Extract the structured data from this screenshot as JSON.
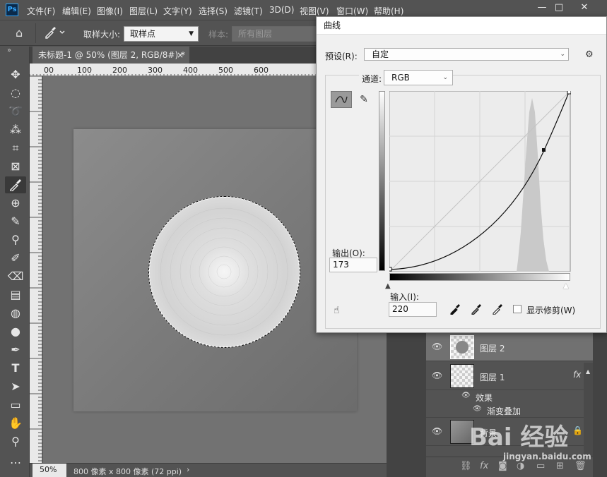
{
  "app": {
    "logo_text": "Ps"
  },
  "menu": [
    "文件(F)",
    "编辑(E)",
    "图像(I)",
    "图层(L)",
    "文字(Y)",
    "选择(S)",
    "滤镜(T)",
    "3D(D)",
    "视图(V)",
    "窗口(W)",
    "帮助(H)"
  ],
  "window_controls": {
    "minimize": "—",
    "maximize": "□",
    "close": "✕"
  },
  "options": {
    "sample_size_label": "取样大小:",
    "sample_size_value": "取样点",
    "sample_label": "样本:",
    "sample_value": "所有图层"
  },
  "document": {
    "tab_title": "未标题-1 @ 50% (图层 2, RGB/8#) *",
    "tab_close": "×",
    "zoom": "50%",
    "info": "800 像素 x 800 像素 (72 ppi)",
    "info_arrow": "›"
  },
  "ruler": {
    "ticks": [
      "00",
      "100",
      "200",
      "300",
      "400",
      "500",
      "600"
    ]
  },
  "curves": {
    "title": "曲线",
    "preset_label": "预设(R):",
    "preset_value": "自定",
    "channel_label": "通道:",
    "channel_value": "RGB",
    "output_label": "输出(O):",
    "output_value": "173",
    "input_label": "输入(I):",
    "input_value": "220",
    "show_clipping_label": "显示修剪(W)"
  },
  "layers": [
    {
      "name": "图层 2",
      "selected": true
    },
    {
      "name": "图层 1",
      "fx": "fx"
    },
    {
      "name": "背景",
      "locked": true
    }
  ],
  "layer_effects": {
    "effects_label": "效果",
    "gradient_overlay_label": "渐变叠加"
  },
  "watermark": {
    "text": "Bai 经验",
    "url": "jingyan.baidu.com"
  }
}
